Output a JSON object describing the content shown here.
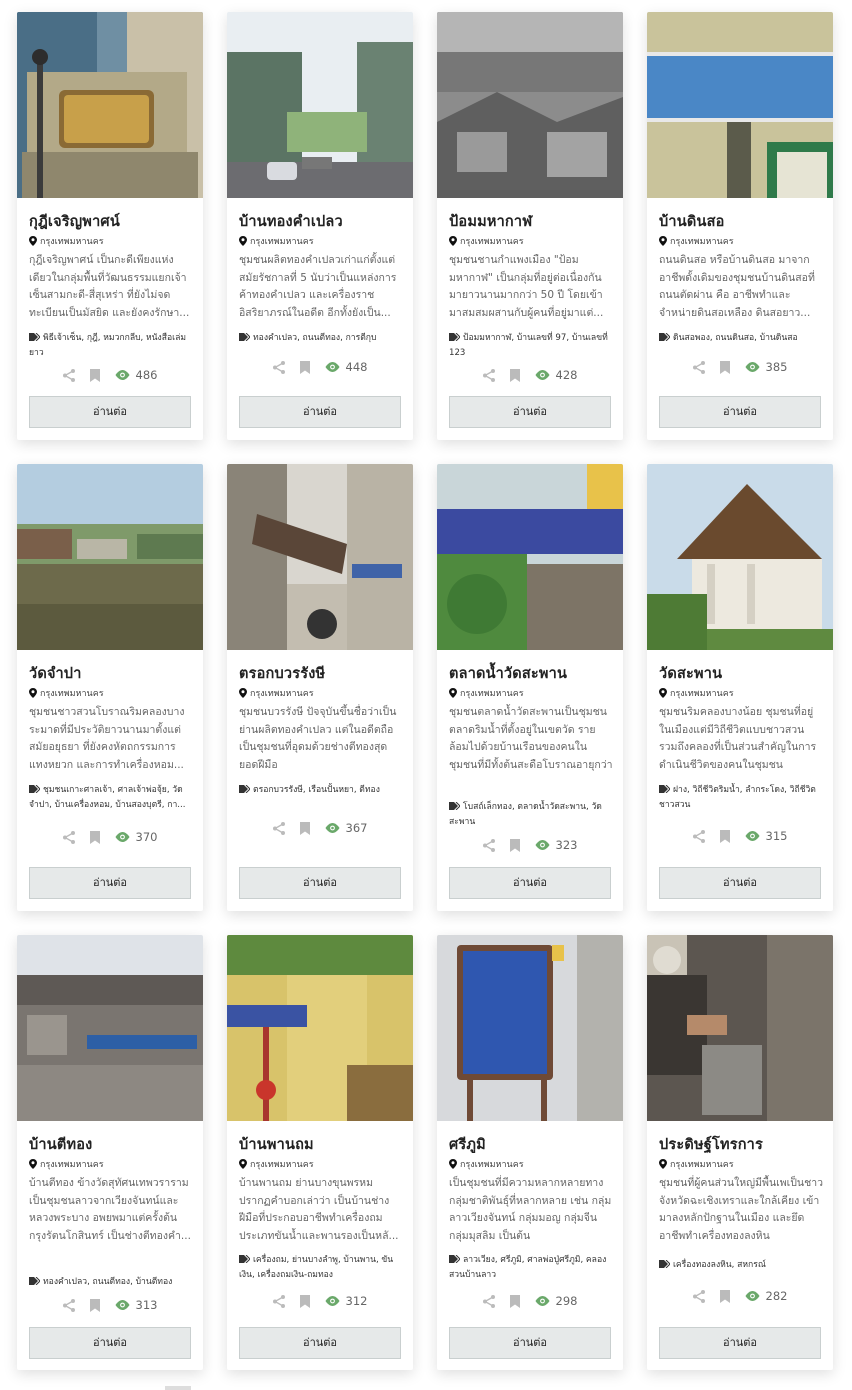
{
  "read_more_label": "อ่านต่อ",
  "accent_color": "#6aa86a",
  "cards": [
    {
      "title": "กุฎีเจริญพาศน์",
      "location": "กรุงเทพมหานคร",
      "description": "กุฎีเจริญพาศน์ เป็นกะดีเพียงแห่งเดียวในกลุ่มพื้นที่วัฒนธรรมแยกเจ้าเซ็นสามกะดี-สี่สุเหร่า ที่ยังไม่จดทะเบียนเป็นมัสยิด และยังคงรักษา...",
      "tags": "พิธีเจ้าเซ็น, กุฎี, หมวกกลีบ, หนังสือเล่มยาว",
      "views": "486",
      "icon": "bookmark-icon"
    },
    {
      "title": "บ้านทองคำเปลว",
      "location": "กรุงเทพมหานคร",
      "description": "ชุมชนผลิตทองคำเปลวเก่าแก่ตั้งแต่สมัยรัชกาลที่ 5 นับว่าเป็นแหล่งการค้าทองคำเปลว และเครื่องราชอิสริยาภรณ์ในอดีต อีกทั้งยังเป็น...",
      "tags": "ทองคำเปลว, ถนนตีทอง, การตีกุบ",
      "views": "448",
      "icon": "bookmark-icon"
    },
    {
      "title": "ป้อมมหากาฬ",
      "location": "กรุงเทพมหานคร",
      "description": "ชุมชนชานกำแพงเมือง \"ป้อมมหากาฬ\" เป็นกลุ่มที่อยู่ต่อเนื่องกันมายาวนานมากกว่า 50 ปี โดยเข้ามาสมสมผสานกับผู้คนที่อยู่มาแต่...",
      "tags": "ป้อมมหากาฬ, บ้านเลขที่ 97, บ้านเลขที่ 123",
      "views": "428",
      "icon": "bookmark-icon"
    },
    {
      "title": "บ้านดินสอ",
      "location": "กรุงเทพมหานคร",
      "description": "ถนนดินสอ หรือบ้านดินสอ มาจากอาชีพดั้งเดิมของชุมชนบ้านดินสอที่ถนนตัดผ่าน คือ อาชีพทำและจำหน่ายดินสอเหลือง ดินสอยาว...",
      "tags": "ดินสอพอง, ถนนดินสอ, บ้านดินสอ",
      "views": "385",
      "icon": "bookmark-icon"
    },
    {
      "title": "วัดจำปา",
      "location": "กรุงเทพมหานคร",
      "description": "ชุมชนชาวสวนโบราณริมคลองบางระมาดที่มีประวัติยาวนานมาตั้งแต่สมัยอยุธยา ที่ยังคงหัตถกรรมการแทงหยวก และการทำเครื่องหอม...",
      "tags": "ชุมชนเกาะศาลเจ้า, ศาลเจ้าพ่อจุ้ย, วัดจำปา, บ้านเครื่องหอม, บ้านสองบุตรี, กา...",
      "views": "370",
      "icon": "bookmark-icon"
    },
    {
      "title": "ตรอกบวรรังษี",
      "location": "กรุงเทพมหานคร",
      "description": "ชุมชนบวรรังษี ปัจจุบันขึ้นชื่อว่าเป็นย่านผลิตทองคำเปลว แต่ในอดีตถือเป็นชุมชนที่อุดมด้วยช่างตีทองสุดยอดฝีมือ",
      "tags": "ตรอกบวรรังษี, เรือนปั้นหยา, ตีทอง",
      "views": "367",
      "icon": "bookmark-icon"
    },
    {
      "title": "ตลาดน้ำวัดสะพาน",
      "location": "กรุงเทพมหานคร",
      "description": "ชุมชนตลาดน้ำวัดสะพานเป็นชุมชนตลาดริมน้ำที่ตั้งอยู่ในเขตวัด รายล้อมไปด้วยบ้านเรือนของคนในชุมชนที่มีทั้งต้นสะดือโบราณอายุกว่า 23...",
      "tags": "โบสถ์เล็กทอง, ตลาดน้ำวัดสะพาน, วัดสะพาน",
      "views": "323",
      "icon": "bookmark-icon"
    },
    {
      "title": "วัดสะพาน",
      "location": "กรุงเทพมหานคร",
      "description": "ชุมชนริมคลองบางน้อย ชุมชนที่อยู่ในเมืองแต่มีวิถีชีวิตแบบชาวสวน รวมถึงคลองที่เป็นส่วนสำคัญในการดำเนินชีวิตของคนในชุมชน",
      "tags": "ฝาง, วิถีชีวิตริมน้ำ, ลำกระโดง, วิถีชีวิตชาวสวน",
      "views": "315",
      "icon": "bookmark-icon"
    },
    {
      "title": "บ้านตีทอง",
      "location": "กรุงเทพมหานคร",
      "description": "บ้านตีทอง ข้างวัดสุทัศนเทพวราราม เป็นชุมชนลาวจากเวียงจันทน์และหลวงพระบาง อพยพมาแต่ครั้งต้นกรุงรัตนโกสินทร์ เป็นช่างตีทองคำ...",
      "tags": "ทองคำเปลว, ถนนตีทอง, บ้านตีทอง",
      "views": "313",
      "icon": "bookmark-icon"
    },
    {
      "title": "บ้านพานถม",
      "location": "กรุงเทพมหานคร",
      "description": "บ้านพานถม ย่านบางขุนพรหม ปรากฏคำบอกเล่าว่า เป็นบ้านช่างฝีมือที่ประกอบอาชีพทำเครื่องถมประเภทขันน้ำและพานรองเป็นหลั...",
      "tags": "เครื่องถม, ย่านบางลำพู, บ้านพาน, ขันเงิน, เครื่องถมเงิน-ถมทอง",
      "views": "312",
      "icon": "bookmark-icon"
    },
    {
      "title": "ศรีภูมิ",
      "location": "กรุงเทพมหานคร",
      "description": "เป็นชุมชนที่มีความหลากหลายทางกลุ่มชาติพันธุ์ที่หลากหลาย เช่น กลุ่มลาวเวียงจันทน์ กลุ่มมอญ กลุ่มจีน กลุ่มมุสลิม เป็นต้น",
      "tags": "ลาวเวียง, ศรีภูมิ, ศาลพ่อปู่ศรีภูมิ, คลองสวนบ้านลาว",
      "views": "298",
      "icon": "bookmark-icon"
    },
    {
      "title": "ประดิษฐ์โทรการ",
      "location": "กรุงเทพมหานคร",
      "description": "ชุมชนที่ผู้คนส่วนใหญ่มีพื้นเพเป็นชาวจังหวัดฉะเชิงเทราและใกล้เคียง เข้ามาลงหลักปักฐานในเมือง และยึดอาชีพทำเครื่องทองลงหิน",
      "tags": "เครื่องทองลงหิน, สหกรณ์",
      "views": "282",
      "icon": "bookmark-icon"
    }
  ]
}
